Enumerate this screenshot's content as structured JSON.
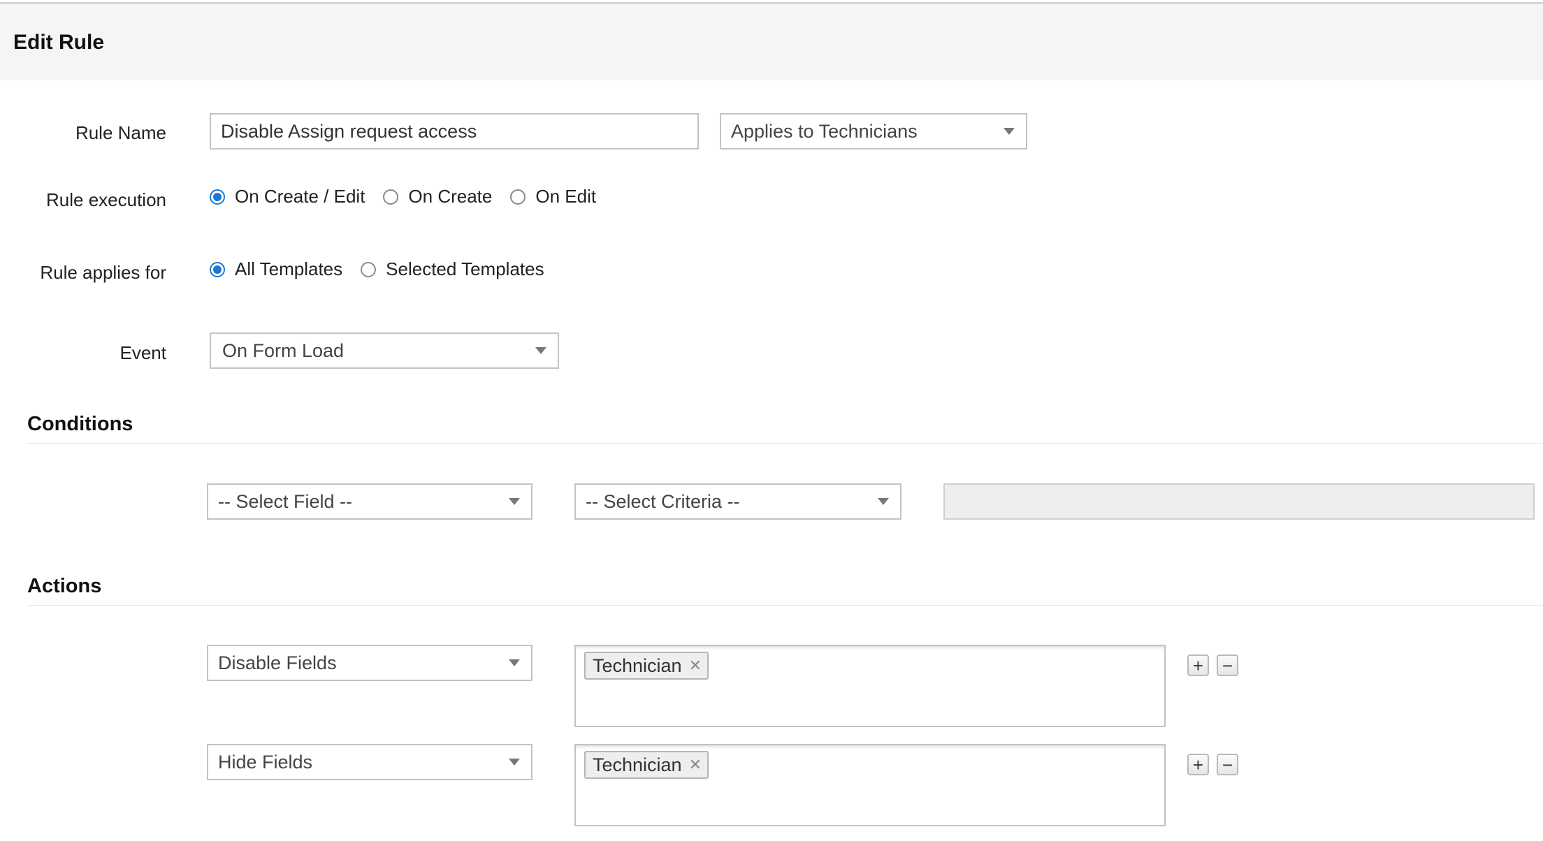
{
  "header": {
    "title": "Edit Rule"
  },
  "form": {
    "rule_name": {
      "label": "Rule Name",
      "value": "Disable Assign request access"
    },
    "applies_to": {
      "value": "Applies to Technicians"
    },
    "rule_execution": {
      "label": "Rule execution",
      "options": [
        "On Create / Edit",
        "On Create",
        "On Edit"
      ],
      "selected": "On Create / Edit"
    },
    "rule_applies_for": {
      "label": "Rule applies for",
      "options": [
        "All Templates",
        "Selected Templates"
      ],
      "selected": "All Templates"
    },
    "event": {
      "label": "Event",
      "value": "On Form Load"
    }
  },
  "conditions": {
    "title": "Conditions",
    "field": "-- Select Field --",
    "criteria": "-- Select Criteria --"
  },
  "actions": {
    "title": "Actions",
    "rows": [
      {
        "action": "Disable Fields",
        "tags": [
          "Technician"
        ],
        "add": "+",
        "remove": "−"
      },
      {
        "action": "Hide Fields",
        "tags": [
          "Technician"
        ],
        "add": "+",
        "remove": "−"
      }
    ]
  },
  "colors": {
    "accent": "#1a78d2",
    "header_bg": "#f5f5f5",
    "border": "#c3c3c3"
  }
}
